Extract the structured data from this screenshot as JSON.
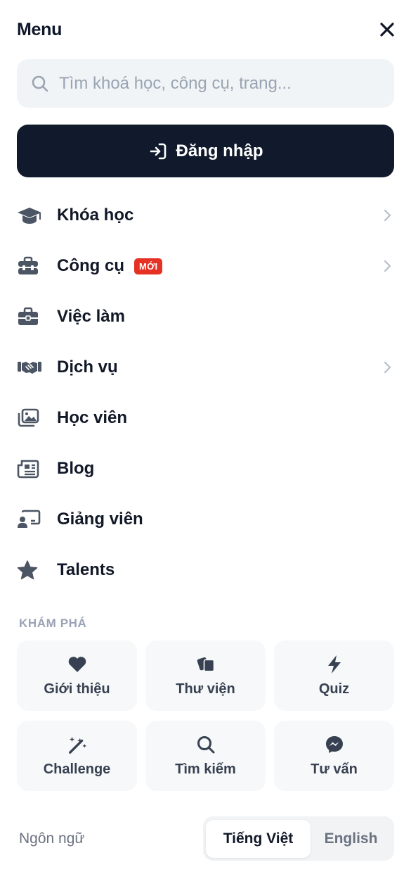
{
  "header": {
    "title": "Menu"
  },
  "search": {
    "placeholder": "Tìm khoá học, công cụ, trang..."
  },
  "login": {
    "label": "Đăng nhập"
  },
  "menu": {
    "items": [
      {
        "label": "Khóa học",
        "icon": "graduation-cap-icon",
        "has_chevron": true
      },
      {
        "label": "Công cụ",
        "icon": "toolbox-icon",
        "badge": "MỚI",
        "has_chevron": true
      },
      {
        "label": "Việc làm",
        "icon": "briefcase-icon",
        "has_chevron": false
      },
      {
        "label": "Dịch vụ",
        "icon": "handshake-icon",
        "has_chevron": true
      },
      {
        "label": "Học viên",
        "icon": "photo-gallery-icon",
        "has_chevron": false
      },
      {
        "label": "Blog",
        "icon": "newspaper-icon",
        "has_chevron": false
      },
      {
        "label": "Giảng viên",
        "icon": "teacher-icon",
        "has_chevron": false
      },
      {
        "label": "Talents",
        "icon": "star-icon",
        "has_chevron": false
      }
    ]
  },
  "explore": {
    "title": "KHÁM PHÁ",
    "tiles": [
      {
        "label": "Giới thiệu",
        "icon": "heart-icon"
      },
      {
        "label": "Thư viện",
        "icon": "cards-icon"
      },
      {
        "label": "Quiz",
        "icon": "bolt-icon"
      },
      {
        "label": "Challenge",
        "icon": "magic-wand-icon"
      },
      {
        "label": "Tìm kiếm",
        "icon": "search-icon"
      },
      {
        "label": "Tư vấn",
        "icon": "messenger-icon"
      }
    ]
  },
  "language": {
    "label": "Ngôn ngữ",
    "options": [
      "Tiếng Việt",
      "English"
    ],
    "selected": "Tiếng Việt"
  },
  "colors": {
    "primary_dark": "#111a2c",
    "badge_red": "#e53224",
    "icon_gray": "#4b5563",
    "muted": "#9aa3b5"
  }
}
